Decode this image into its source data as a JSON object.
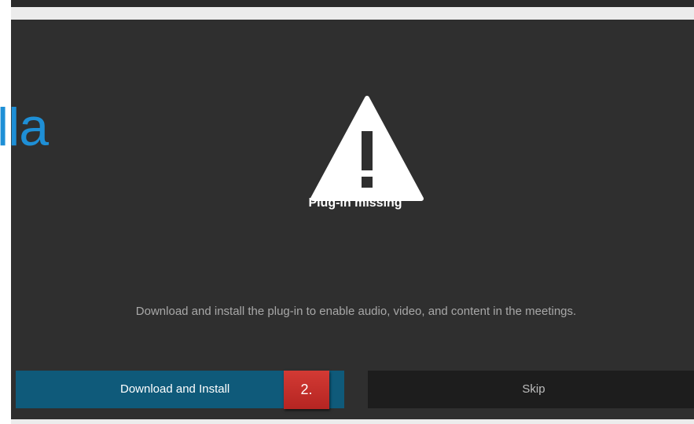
{
  "background_overlay": {
    "partial_text": "lla",
    "color": "#1e8fd6"
  },
  "dialog": {
    "icon": "warning-triangle-icon",
    "title": "Plug-in missing",
    "message": "Download and install the plug-in to enable audio, video, and content in the meetings.",
    "buttons": {
      "download_install": "Download and Install",
      "skip": "Skip"
    },
    "colors": {
      "background": "#2f2f2f",
      "primary_button": "#0f5a7a",
      "secondary_button": "#1d1d1d"
    }
  },
  "annotation": {
    "step_label": "2.",
    "color": "#c9302c"
  }
}
